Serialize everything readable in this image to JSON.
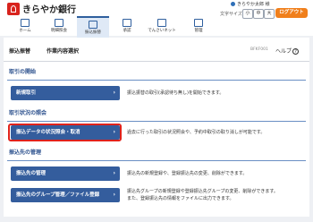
{
  "header": {
    "bank_name": "きらやか銀行",
    "user_label": "きらやか太郎 様",
    "font_size_label": "文字サイズ",
    "font_small": "小",
    "font_medium": "中",
    "font_large": "大",
    "logout_label": "ログアウト"
  },
  "nav": {
    "items": [
      {
        "label": "ホーム"
      },
      {
        "label": "明細照会"
      },
      {
        "label": "振込振替"
      },
      {
        "label": "承認"
      },
      {
        "label": "でんさいネット"
      },
      {
        "label": "管理"
      }
    ]
  },
  "main": {
    "breadcrumb": "振込振替",
    "page_title": "作業内容選択",
    "screen_id": "BFKF001",
    "help_label": "ヘルプ",
    "help_icon": "?",
    "chevron": "›",
    "sections": [
      {
        "title": "取引の開始",
        "buttons": [
          {
            "label": "新規取引",
            "description": "振込振替の取引(承認待ち無し)を開始できます。"
          }
        ]
      },
      {
        "title": "取引状況の照会",
        "buttons": [
          {
            "label": "振込データの状況照会・取消",
            "description": "過去に行った取引の状況照会や、予約中取引の取り消しが可能です。"
          }
        ]
      },
      {
        "title": "振込先の管理",
        "buttons": [
          {
            "label": "振込先の管理",
            "description": "振込先の新規登録や、登録振込先の変更、削除ができます。"
          },
          {
            "label": "振込先のグループ管理／ファイル登録",
            "description": "振込先グループの新規登録や登録振込先グループの変更、削除ができます。",
            "description2": "また、登録振込先の情報をファイルに出力できます。"
          }
        ]
      }
    ]
  }
}
